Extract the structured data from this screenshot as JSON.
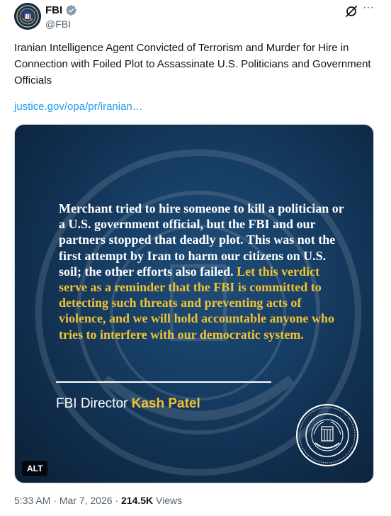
{
  "author": {
    "display_name": "FBI",
    "handle": "@FBI",
    "avatar_icon": "fbi-seal-icon",
    "verified_icon": "verified-badge-icon",
    "verified_color": "#829aab"
  },
  "actions": {
    "grok_icon": "grok-icon",
    "more_icon": "more-icon",
    "more_label": "···"
  },
  "post": {
    "text": "Iranian Intelligence Agent Convicted of Terrorism and Murder for Hire in Connection with Foiled Plot to Assassinate U.S. Politicians and Government Officials",
    "link": "justice.gov/opa/pr/iranian…"
  },
  "media": {
    "quote_white": "Merchant tried to hire someone to kill a politician or a U.S. government official, but the FBI and our partners stopped that deadly plot. This was not the first attempt by Iran to harm our citizens on U.S. soil; the other efforts also failed. ",
    "quote_highlight": "Let this verdict serve as a reminder that the FBI is committed to detecting such threats and preventing acts of violence, and we will hold accountable anyone who tries to interfere with our democratic system.",
    "attribution_title": "FBI Director ",
    "attribution_name": "Kash Patel",
    "alt_label": "ALT",
    "highlight_color": "#f2c233",
    "background_color": "#173f66",
    "seal_icon": "fbi-seal-icon"
  },
  "meta": {
    "time": "5:33 AM",
    "separator1": " · ",
    "date": "Mar 7, 2026",
    "separator2": " · ",
    "views_count": "214.5K",
    "views_label": " Views"
  },
  "colors": {
    "link": "#1d9bf0",
    "secondary_text": "#536471",
    "primary_text": "#0f1419"
  }
}
